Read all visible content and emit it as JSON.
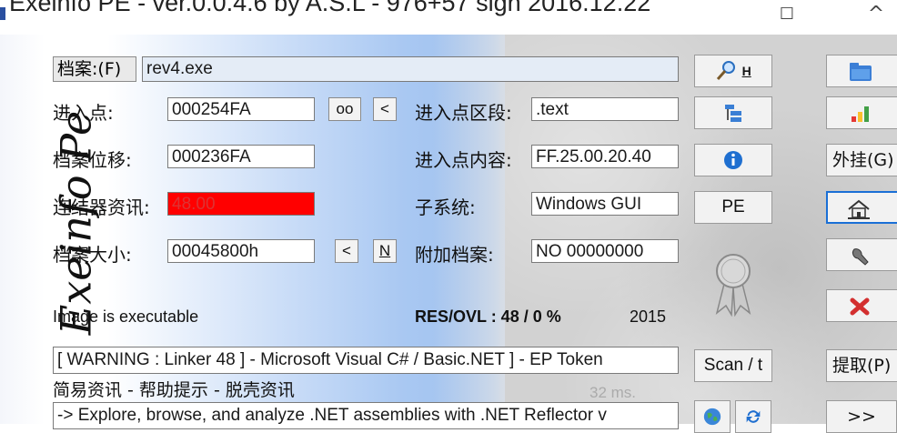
{
  "window": {
    "title": "Exeinfo PE - ver.0.0.4.6  by A.S.L -  976+57 sign  2016.12.22",
    "minimize_glyph": "☐",
    "maximize_glyph": "^"
  },
  "watermark": "Exeinfo Pe",
  "file": {
    "label": "档案:(F)",
    "value": "rev4.exe"
  },
  "fields": {
    "entry_point_label": "进入点:",
    "entry_point_value": "000254FA",
    "oo_button": "oo",
    "lt_button": "<",
    "entry_section_label": "进入点区段:",
    "entry_section_value": ".text",
    "file_offset_label": "档案位移:",
    "file_offset_value": "000236FA",
    "entry_content_label": "进入点内容:",
    "entry_content_value": "FF.25.00.20.40",
    "linker_label": "连结器资讯:",
    "linker_value": "48.00",
    "subsystem_label": "子系统:",
    "subsystem_value": "Windows GUI",
    "file_size_label": "档案大小:",
    "file_size_value": "00045800h",
    "size_lt_button": "<",
    "size_n_button": "N",
    "overlay_label": "附加档案:",
    "overlay_value": "NO  00000000"
  },
  "status": {
    "executable": "Image is executable",
    "res_ovl": "RES/OVL : 48 / 0 %",
    "year": "2015",
    "warning": "[ WARNING : Linker 48 ] - Microsoft Visual C# / Basic.NET ]  - EP Token",
    "help_line": "简易资讯 - 帮助提示 - 脱壳资讯",
    "hint": "-> Explore, browse, and analyze .NET assemblies with .NET Reflector v",
    "ms": "32 ms."
  },
  "mid_buttons": {
    "search_h": "H",
    "pe": "PE",
    "scan": "Scan / t"
  },
  "right_buttons": {
    "plugins": "外挂(G)",
    "extract": "提取(P)",
    "more": ">>"
  },
  "colors": {
    "linker_bg": "#ff0000",
    "accent": "#1a6fd6"
  }
}
